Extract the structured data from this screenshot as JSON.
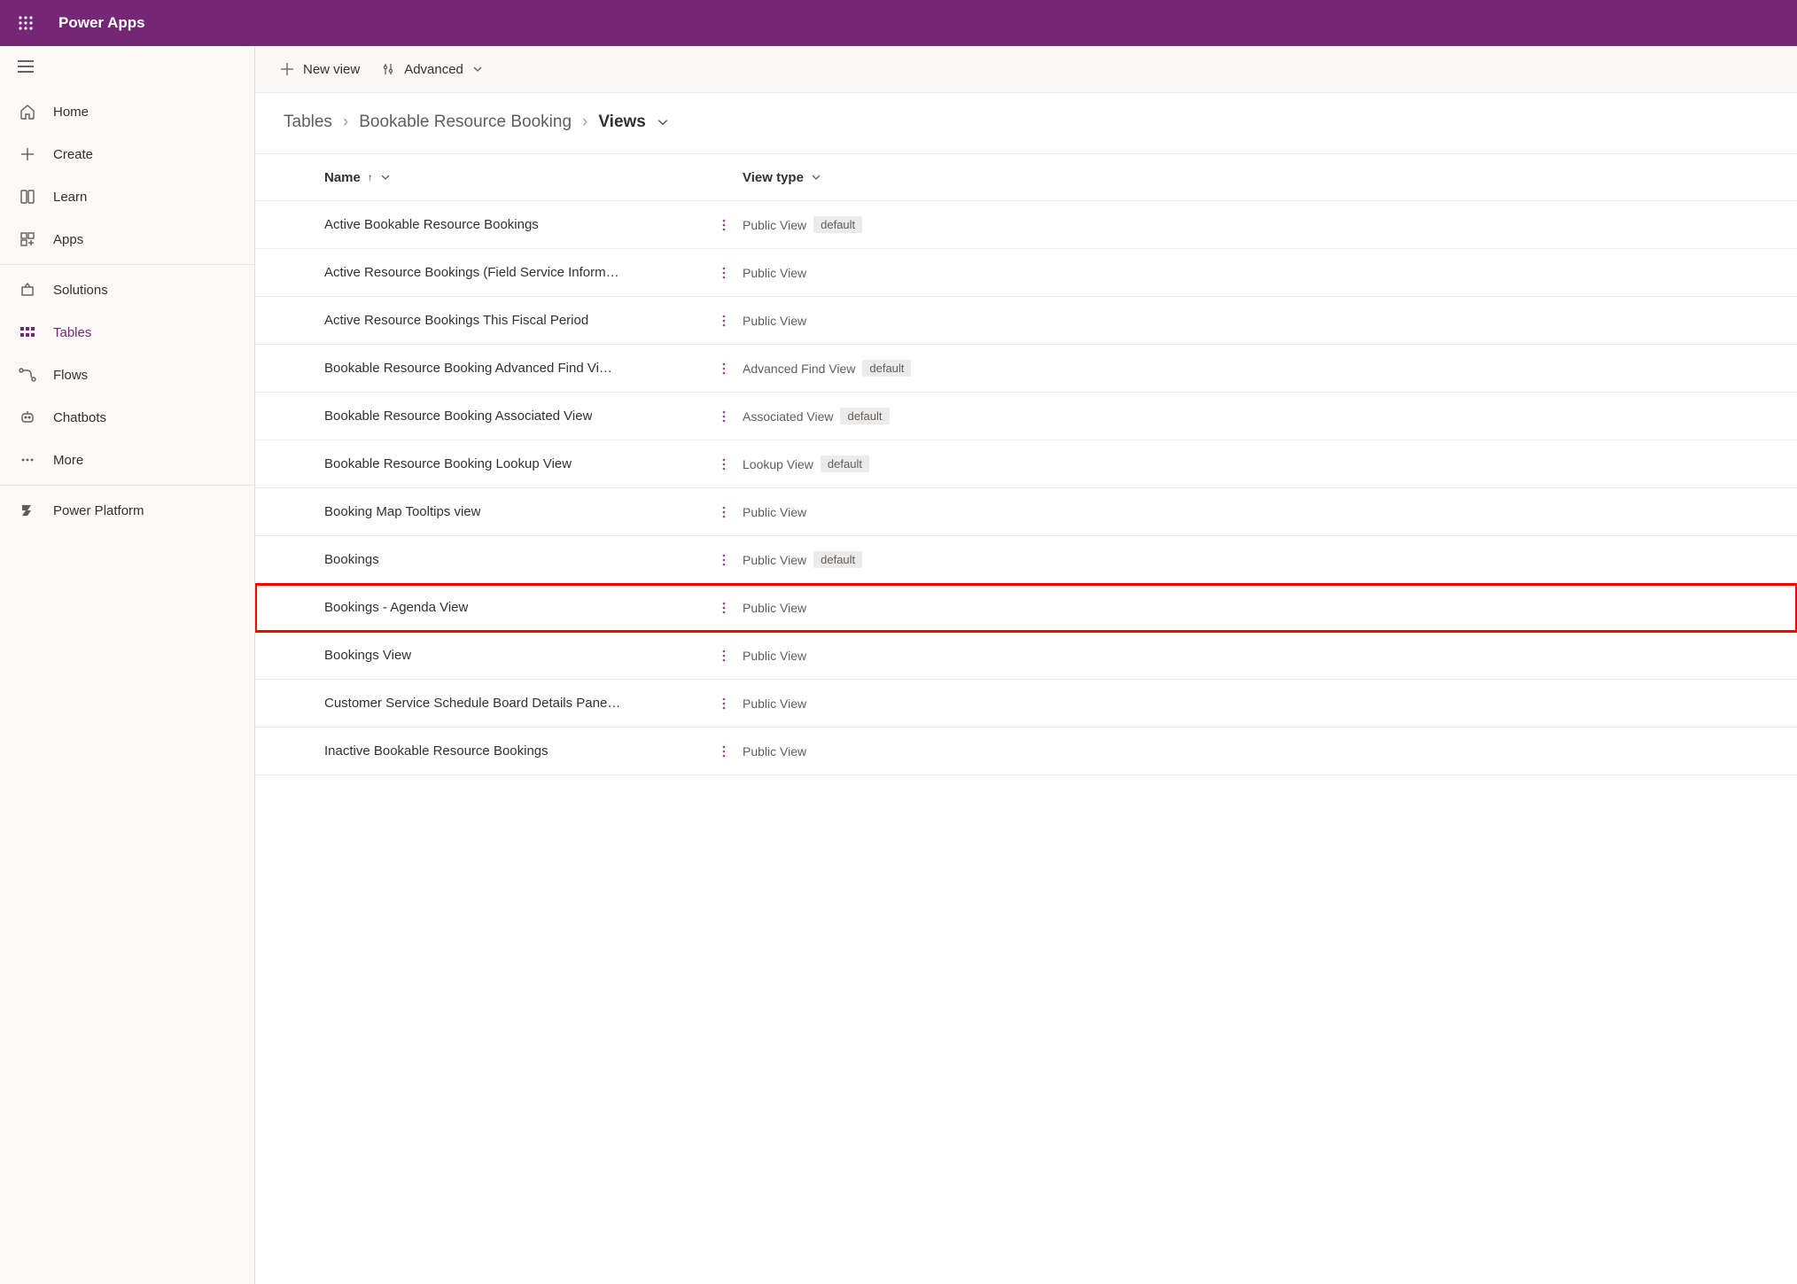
{
  "header": {
    "appTitle": "Power Apps"
  },
  "sidebar": {
    "group1": [
      {
        "id": "home",
        "label": "Home"
      },
      {
        "id": "create",
        "label": "Create"
      },
      {
        "id": "learn",
        "label": "Learn"
      },
      {
        "id": "apps",
        "label": "Apps"
      }
    ],
    "group2": [
      {
        "id": "solutions",
        "label": "Solutions"
      },
      {
        "id": "tables",
        "label": "Tables"
      },
      {
        "id": "flows",
        "label": "Flows"
      },
      {
        "id": "chatbots",
        "label": "Chatbots"
      },
      {
        "id": "more",
        "label": "More"
      }
    ],
    "group3": [
      {
        "id": "powerplatform",
        "label": "Power Platform"
      }
    ],
    "activeId": "tables"
  },
  "toolbar": {
    "newView": "New view",
    "advanced": "Advanced"
  },
  "breadcrumb": {
    "items": [
      "Tables",
      "Bookable Resource Booking",
      "Views"
    ]
  },
  "grid": {
    "headers": {
      "name": "Name",
      "viewType": "View type"
    },
    "defaultBadge": "default",
    "rows": [
      {
        "name": "Active Bookable Resource Bookings",
        "type": "Public View",
        "default": true
      },
      {
        "name": "Active Resource Bookings (Field Service Inform…",
        "type": "Public View",
        "default": false
      },
      {
        "name": "Active Resource Bookings This Fiscal Period",
        "type": "Public View",
        "default": false
      },
      {
        "name": "Bookable Resource Booking Advanced Find Vi…",
        "type": "Advanced Find View",
        "default": true
      },
      {
        "name": "Bookable Resource Booking Associated View",
        "type": "Associated View",
        "default": true
      },
      {
        "name": "Bookable Resource Booking Lookup View",
        "type": "Lookup View",
        "default": true
      },
      {
        "name": "Booking Map Tooltips view",
        "type": "Public View",
        "default": false
      },
      {
        "name": "Bookings",
        "type": "Public View",
        "default": true
      },
      {
        "name": "Bookings - Agenda View",
        "type": "Public View",
        "default": false,
        "highlight": true
      },
      {
        "name": "Bookings View",
        "type": "Public View",
        "default": false
      },
      {
        "name": "Customer Service Schedule Board Details Pane…",
        "type": "Public View",
        "default": false
      },
      {
        "name": "Inactive Bookable Resource Bookings",
        "type": "Public View",
        "default": false
      }
    ]
  }
}
